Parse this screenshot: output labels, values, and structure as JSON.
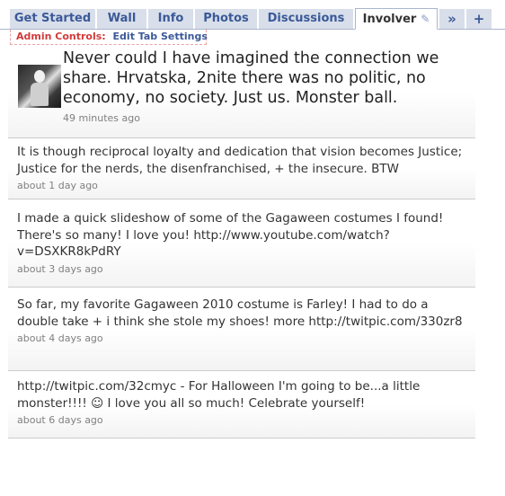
{
  "tabs": [
    {
      "label": "Get Started"
    },
    {
      "label": "Wall"
    },
    {
      "label": "Info"
    },
    {
      "label": "Photos"
    },
    {
      "label": "Discussions"
    },
    {
      "label": "Involver"
    }
  ],
  "tab_icons": {
    "edit": "pencil-icon",
    "more": "double-chevron-right-icon",
    "add": "plus-icon"
  },
  "admin": {
    "label": "Admin Controls:",
    "link": "Edit Tab Settings"
  },
  "featured": {
    "text": "Never could I have imagined the connection we share. Hrvatska, 2nite there was no politic, no economy, no society. Just us. Monster ball.",
    "time": "49 minutes ago"
  },
  "posts": [
    {
      "text": "It is though reciprocal loyalty and dedication that vision becomes Justice; Justice for the nerds, the disenfranchised, + the insecure. BTW",
      "time": "about 1 day ago"
    },
    {
      "text": "I made a quick slideshow of some of the Gagaween costumes I found! There's so many! I love you! http://www.youtube.com/watch?v=DSXKR8kPdRY",
      "time": "about 3 days ago"
    },
    {
      "text": "So far, my favorite Gagaween 2010 costume is Farley! I had to do a double take + i think she stole my shoes! more http://twitpic.com/330zr8",
      "time": "about 4 days ago"
    },
    {
      "text": "http://twitpic.com/32cmyc - For Halloween I'm going to be...a little monster!!!! ☺ I love you all so much! Celebrate yourself!",
      "time": "about 6 days ago"
    }
  ],
  "colors": {
    "link": "#3b5998",
    "tab_bg": "#d8dfea",
    "admin_label": "#d23b3b",
    "timestamp": "#808080"
  }
}
